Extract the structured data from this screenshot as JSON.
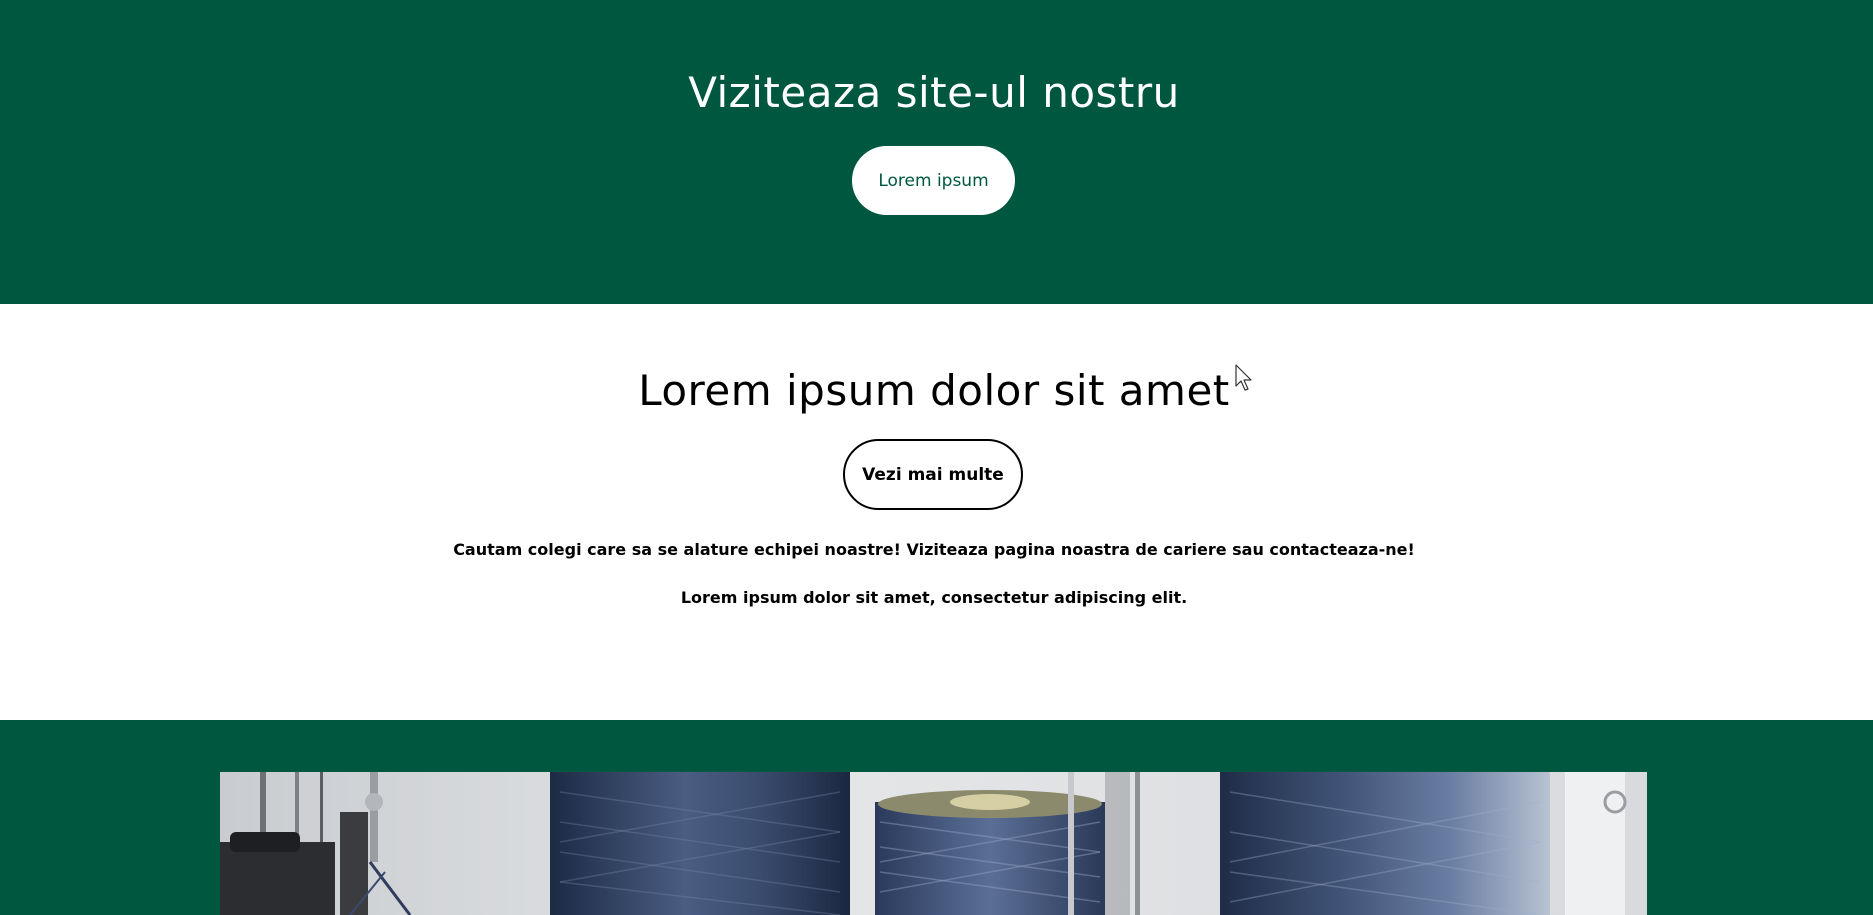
{
  "hero": {
    "title": "Viziteaza site-ul nostru",
    "button_label": "Lorem ipsum"
  },
  "section": {
    "title": "Lorem ipsum dolor sit amet",
    "button_label": "Vezi mai multe",
    "paragraph_1": "Cautam colegi care sa se alature echipei noastre! Viziteaza pagina noastra de cariere sau contacteaza-ne!",
    "paragraph_2": "Lorem ipsum dolor sit amet, consectetur adipiscing elit."
  },
  "colors": {
    "brand_green": "#005740",
    "white": "#ffffff",
    "text": "#000000"
  },
  "image": {
    "subject": "textile-thread-spools-photo"
  }
}
